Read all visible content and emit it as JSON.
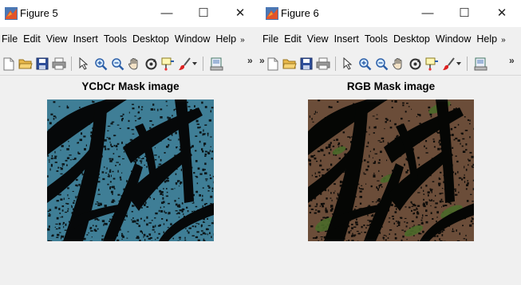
{
  "figure5": {
    "window_title": "Figure 5",
    "menu": [
      "File",
      "Edit",
      "View",
      "Insert",
      "Tools",
      "Desktop",
      "Window",
      "Help"
    ],
    "axes_title": "YCbCr Mask image",
    "image_palette": {
      "background": "#3f7e96",
      "speckle": "#0b1518",
      "leaf": "#060809"
    }
  },
  "figure6": {
    "window_title": "Figure 6",
    "menu": [
      "File",
      "Edit",
      "View",
      "Insert",
      "Tools",
      "Desktop",
      "Window",
      "Help"
    ],
    "axes_title": "RGB Mask image",
    "image_palette": {
      "background": "#6b4d39",
      "speckle": "#0e0c09",
      "leaf": "#050604",
      "green": "#4b6a2a"
    }
  },
  "window_controls": {
    "minimize": "—",
    "maximize": "☐",
    "close": "✕"
  },
  "toolbar_icons": [
    "new-figure-icon",
    "open-folder-icon",
    "save-icon",
    "print-icon",
    "arrow-select-icon",
    "zoom-in-icon",
    "zoom-out-icon",
    "pan-hand-icon",
    "rotate-3d-icon",
    "data-cursor-icon",
    "brush-icon",
    "dropdown-arrow-icon",
    "link-plot-icon"
  ],
  "menu_overflow_glyph": "»",
  "toolbar_overflow_glyph": "»"
}
